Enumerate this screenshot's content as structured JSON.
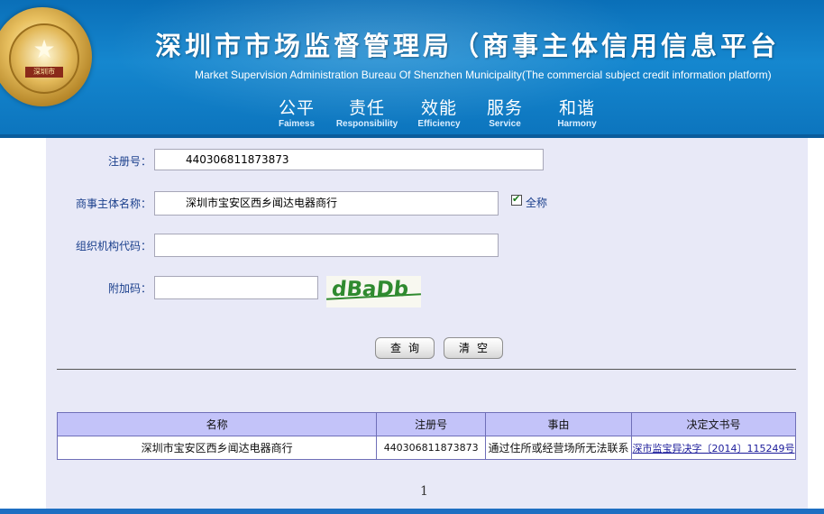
{
  "header": {
    "title_cn": "深圳市市场监督管理局（商事主体信用信息平台",
    "title_en": "Market  Supervision  Administration Bureau Of Shenzhen Municipality(The commercial subject credit information platform)",
    "emblem_text": "深圳市",
    "motto": [
      {
        "cn": "公平",
        "en": "Faimess"
      },
      {
        "cn": "责任",
        "en": "Responsibility"
      },
      {
        "cn": "效能",
        "en": "Efficiency"
      },
      {
        "cn": "服务",
        "en": "Service"
      },
      {
        "cn": "和谐",
        "en": "Harmony"
      }
    ]
  },
  "form": {
    "reg_no_label": "注册号：",
    "reg_no_value": "440306811873873",
    "name_label": "商事主体名称：",
    "name_value": "深圳市宝安区西乡闻达电器商行",
    "fullname_checkbox_checked": true,
    "fullname_label": "全称",
    "org_code_label": "组织机构代码：",
    "org_code_value": "",
    "captcha_label": "附加码：",
    "captcha_value": "",
    "captcha_image_text": "dBaDb",
    "query_button": "查询",
    "clear_button": "清空"
  },
  "results": {
    "headers": [
      "名称",
      "注册号",
      "事由",
      "决定文书号"
    ],
    "rows": [
      {
        "name": "深圳市宝安区西乡闻达电器商行",
        "reg_no": "440306811873873",
        "reason": "通过住所或经营场所无法联系",
        "doc_no": "深市监宝异决字〔2014〕115249号"
      }
    ]
  },
  "pager": {
    "current": "1"
  },
  "colors": {
    "header_blue": "#1587cf",
    "panel_bg": "#e8e9f7",
    "table_header": "#c3c3f9",
    "label_text": "#1a3f8c"
  }
}
